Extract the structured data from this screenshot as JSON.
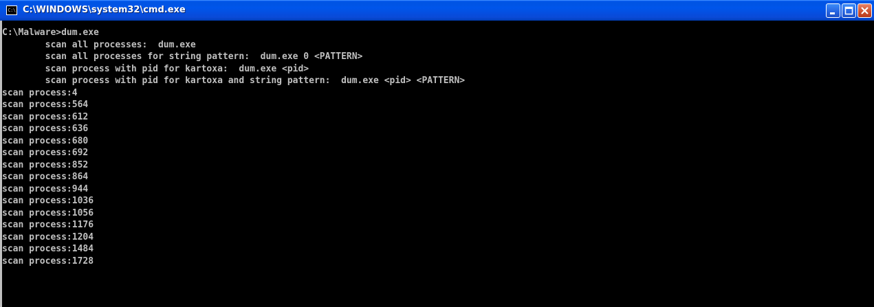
{
  "window": {
    "title": "C:\\WINDOWS\\system32\\cmd.exe",
    "app_icon_text": "C:\\"
  },
  "colors": {
    "titlebar": "#0054e3",
    "console_background": "#000000",
    "console_text": "#c0c0c0",
    "close_button": "#d1532f"
  },
  "console": {
    "lines": [
      "C:\\Malware>dum.exe",
      "        scan all processes:  dum.exe",
      "        scan all processes for string pattern:  dum.exe 0 <PATTERN>",
      "        scan process with pid for kartoxa:  dum.exe <pid>",
      "        scan process with pid for kartoxa and string pattern:  dum.exe <pid> <PATTERN>",
      "scan process:4",
      "scan process:564",
      "scan process:612",
      "scan process:636",
      "scan process:680",
      "scan process:692",
      "scan process:852",
      "scan process:864",
      "scan process:944",
      "scan process:1036",
      "scan process:1056",
      "scan process:1176",
      "scan process:1204",
      "scan process:1484",
      "scan process:1728"
    ]
  }
}
